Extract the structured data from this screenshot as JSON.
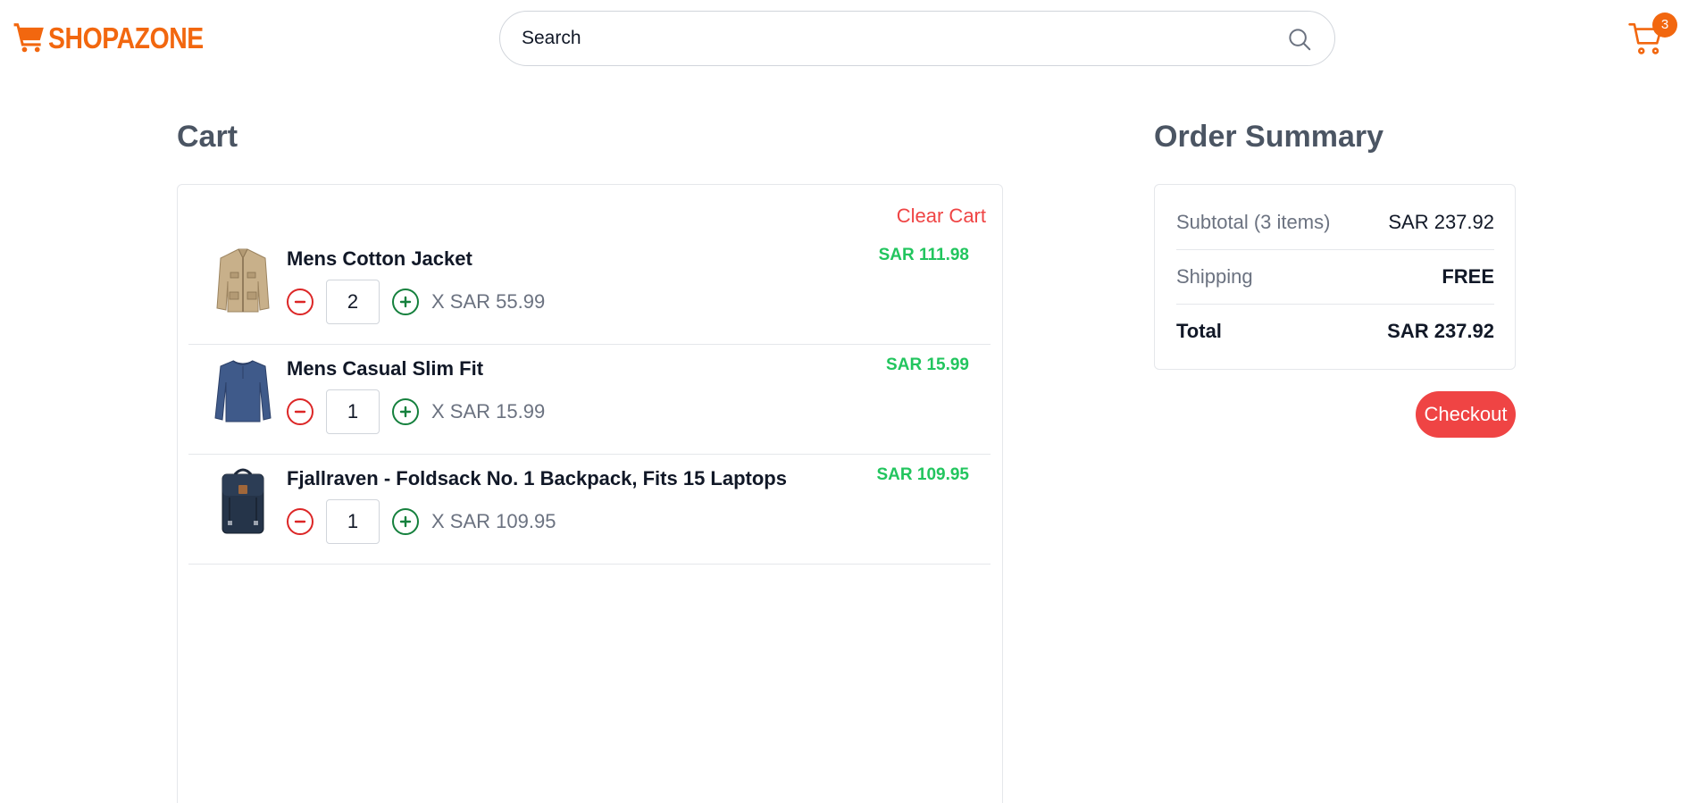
{
  "header": {
    "logo_text": "SHOPAZONE",
    "search_placeholder": "Search",
    "cart_count": "3",
    "brand_color": "#f2670f"
  },
  "cart": {
    "title": "Cart",
    "clear_label": "Clear Cart",
    "items": [
      {
        "name": "Mens Cotton Jacket",
        "quantity": "2",
        "unit_price": "X SAR 55.99",
        "total": "SAR 111.98",
        "image_icon": "jacket-image"
      },
      {
        "name": "Mens Casual Slim Fit",
        "quantity": "1",
        "unit_price": "X SAR 15.99",
        "total": "SAR 15.99",
        "image_icon": "shirt-image"
      },
      {
        "name": "Fjallraven - Foldsack No. 1 Backpack, Fits 15 Laptops",
        "quantity": "1",
        "unit_price": "X SAR 109.95",
        "total": "SAR 109.95",
        "image_icon": "backpack-image"
      }
    ]
  },
  "summary": {
    "title": "Order Summary",
    "subtotal_label": "Subtotal (3 items)",
    "subtotal_value": "SAR 237.92",
    "shipping_label": "Shipping",
    "shipping_value": "FREE",
    "total_label": "Total",
    "total_value": "SAR 237.92",
    "checkout_label": "Checkout"
  },
  "colors": {
    "accent": "#f2670f",
    "danger": "#ef4444",
    "price_green": "#22c55e",
    "plus_green": "#15803d"
  }
}
